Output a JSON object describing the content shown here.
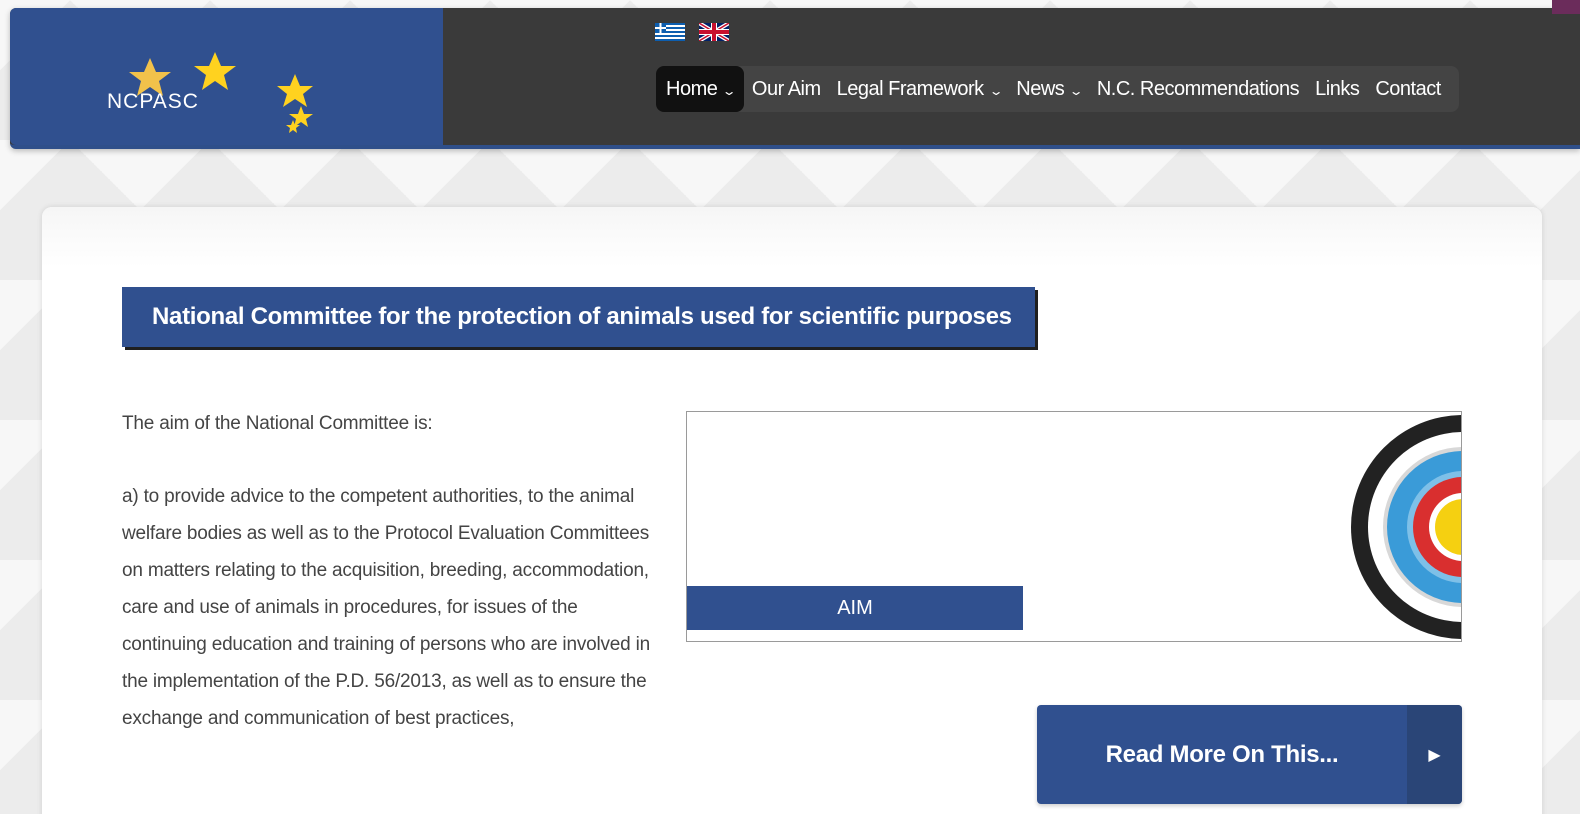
{
  "colors": {
    "brand_blue": "#30508f",
    "header_dark": "#3a3a3a",
    "nav_active": "#111111",
    "text_gray": "#444444"
  },
  "header": {
    "logo_text": "NCPASC",
    "flags": [
      {
        "icon": "greek-flag-icon"
      },
      {
        "icon": "uk-flag-icon"
      }
    ],
    "nav": [
      {
        "label": "Home",
        "dropdown": true,
        "active": true
      },
      {
        "label": "Our Aim",
        "dropdown": false,
        "active": false
      },
      {
        "label": "Legal Framework",
        "dropdown": true,
        "active": false
      },
      {
        "label": "News",
        "dropdown": true,
        "active": false
      },
      {
        "label": "N.C. Recommendations",
        "dropdown": false,
        "active": false
      },
      {
        "label": "Links",
        "dropdown": false,
        "active": false
      },
      {
        "label": "Contact",
        "dropdown": false,
        "active": false
      }
    ]
  },
  "main": {
    "title": "National Committee for the protection of animals used for scientific purposes",
    "intro": "The aim of the National Committee is:",
    "paragraph_a": "a) to provide advice to the competent authorities, to the animal welfare bodies as well as to the Protocol Evaluation Committees on matters relating to the acquisition, breeding, accommodation, care and use of animals in procedures, for issues of the continuing education and training of persons who are involved in the implementation of the P.D. 56/2013, as well as to ensure the exchange and communication of best practices,",
    "aim_label": "AIM",
    "aim_image_icon": "target-icon",
    "read_more_label": "Read More On This...",
    "read_more_icon": "play-arrow-icon"
  }
}
